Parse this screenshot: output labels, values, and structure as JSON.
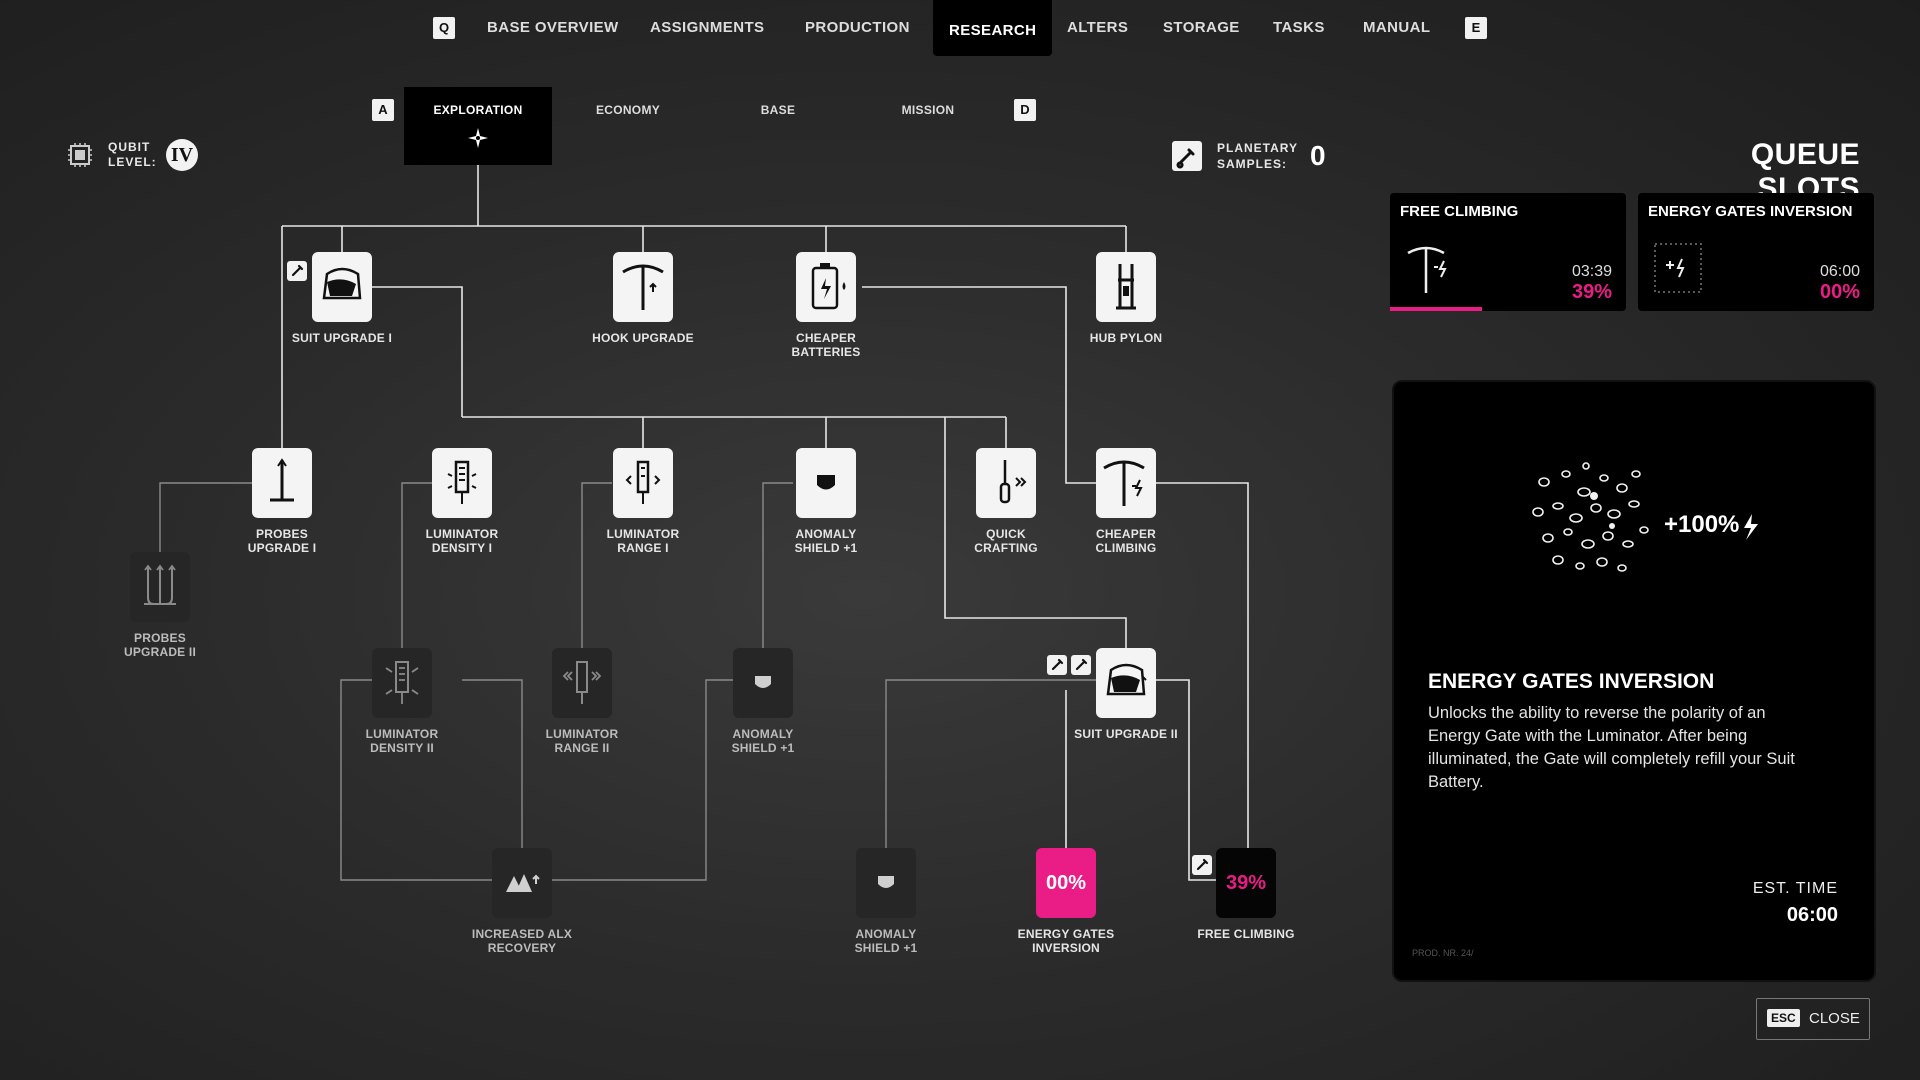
{
  "nav": {
    "key_left": "Q",
    "key_right": "E",
    "items": [
      {
        "label": "BASE OVERVIEW"
      },
      {
        "label": "ASSIGNMENTS"
      },
      {
        "label": "PRODUCTION"
      },
      {
        "label": "RESEARCH",
        "active": true
      },
      {
        "label": "ALTERS"
      },
      {
        "label": "STORAGE"
      },
      {
        "label": "TASKS"
      },
      {
        "label": "MANUAL"
      }
    ]
  },
  "categories": {
    "key_left": "A",
    "key_right": "D",
    "items": [
      {
        "label": "EXPLORATION",
        "active": true
      },
      {
        "label": "ECONOMY"
      },
      {
        "label": "BASE"
      },
      {
        "label": "MISSION"
      }
    ]
  },
  "qubit": {
    "label_line1": "QUBIT",
    "label_line2": "LEVEL:",
    "value": "IV"
  },
  "samples": {
    "label_line1": "PLANETARY",
    "label_line2": "SAMPLES:",
    "value": "0"
  },
  "tree": {
    "suit_upgrade_1": "SUIT UPGRADE I",
    "hook_upgrade": "HOOK UPGRADE",
    "cheaper_batteries": [
      "CHEAPER",
      "BATTERIES"
    ],
    "hub_pylon": "HUB PYLON",
    "probes_upgrade_1": [
      "PROBES",
      "UPGRADE I"
    ],
    "luminator_density_1": [
      "LUMINATOR",
      "DENSITY I"
    ],
    "luminator_range_1": [
      "LUMINATOR",
      "RANGE I"
    ],
    "anomaly_shield_a": [
      "ANOMALY",
      "SHIELD +1"
    ],
    "quick_crafting": [
      "QUICK",
      "CRAFTING"
    ],
    "cheaper_climbing": [
      "CHEAPER",
      "CLIMBING"
    ],
    "probes_upgrade_2": [
      "PROBES",
      "UPGRADE II"
    ],
    "luminator_density_2": [
      "LUMINATOR",
      "DENSITY II"
    ],
    "luminator_range_2": [
      "LUMINATOR",
      "RANGE II"
    ],
    "anomaly_shield_b": [
      "ANOMALY",
      "SHIELD +1"
    ],
    "suit_upgrade_2": "SUIT UPGRADE II",
    "increased_alx": [
      "INCREASED ALX",
      "RECOVERY"
    ],
    "anomaly_shield_c": [
      "ANOMALY",
      "SHIELD +1"
    ],
    "energy_gates": [
      "ENERGY GATES",
      "INVERSION"
    ],
    "energy_gates_pct": "00%",
    "free_climbing": "FREE CLIMBING",
    "free_climbing_pct": "39%"
  },
  "queue": {
    "title": "QUEUE SLOTS",
    "slots": [
      {
        "name": "FREE CLIMBING",
        "time": "03:39",
        "percent": "39%",
        "progress": 0.39
      },
      {
        "name": "ENERGY GATES INVERSION",
        "time": "06:00",
        "percent": "00%",
        "progress": 0
      }
    ]
  },
  "detail": {
    "art_bonus": "+100%",
    "title": "ENERGY GATES INVERSION",
    "description": "Unlocks the ability to reverse the polarity of an Energy Gate with the Luminator. After being illuminated, the Gate will completely refill your Suit Battery.",
    "est_label": "EST. TIME",
    "est_value": "06:00",
    "prod_code": "PROD. NR. 24/"
  },
  "close": {
    "key": "ESC",
    "label": "CLOSE"
  },
  "colors": {
    "accent": "#ea1d86",
    "panel": "#000000",
    "node_active": "#f4f4f4",
    "node_locked": "#262626"
  }
}
